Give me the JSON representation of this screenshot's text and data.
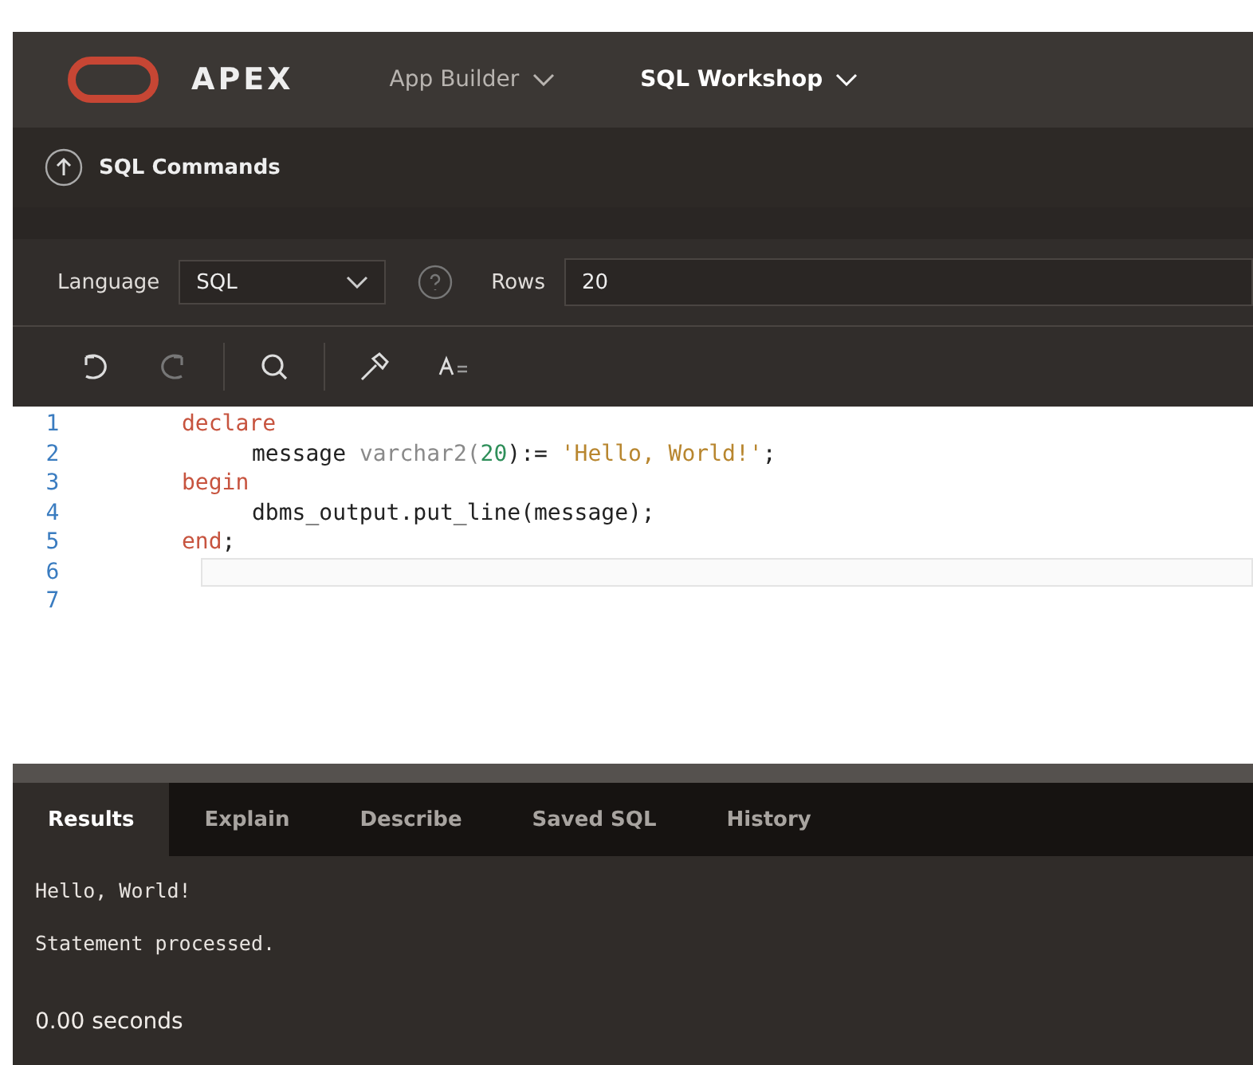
{
  "header": {
    "logo_text": "APEX",
    "menus": [
      {
        "label": "App Builder",
        "selected": false
      },
      {
        "label": "SQL Workshop",
        "selected": true
      }
    ]
  },
  "breadcrumb": {
    "title": "SQL Commands"
  },
  "options": {
    "language_label": "Language",
    "language_value": "SQL",
    "rows_label": "Rows",
    "rows_value": "20"
  },
  "editor": {
    "lines": [
      {
        "number": "1",
        "current": false,
        "indent": false,
        "tokens": [
          {
            "kind": "keyword",
            "text": "declare"
          }
        ]
      },
      {
        "number": "2",
        "current": false,
        "indent": true,
        "tokens": [
          {
            "kind": "plain",
            "text": "message "
          },
          {
            "kind": "type",
            "text": "varchar2("
          },
          {
            "kind": "number",
            "text": "20"
          },
          {
            "kind": "plain",
            "text": "):= "
          },
          {
            "kind": "string",
            "text": "'Hello, World!'"
          },
          {
            "kind": "plain",
            "text": ";"
          }
        ]
      },
      {
        "number": "3",
        "current": false,
        "indent": false,
        "tokens": [
          {
            "kind": "keyword",
            "text": "begin"
          }
        ]
      },
      {
        "number": "4",
        "current": false,
        "indent": true,
        "tokens": [
          {
            "kind": "plain",
            "text": "dbms_output.put_line(message);"
          }
        ]
      },
      {
        "number": "5",
        "current": false,
        "indent": false,
        "tokens": [
          {
            "kind": "keyword",
            "text": "end"
          },
          {
            "kind": "plain",
            "text": ";"
          }
        ]
      },
      {
        "number": "6",
        "current": true
      },
      {
        "number": "7",
        "current": false
      }
    ]
  },
  "results": {
    "tabs": [
      {
        "label": "Results",
        "selected": true
      },
      {
        "label": "Explain",
        "selected": false
      },
      {
        "label": "Describe",
        "selected": false
      },
      {
        "label": "Saved SQL",
        "selected": false
      },
      {
        "label": "History",
        "selected": false
      }
    ],
    "output": [
      "Hello, World!",
      "Statement processed."
    ],
    "timing": "0.00 seconds"
  }
}
